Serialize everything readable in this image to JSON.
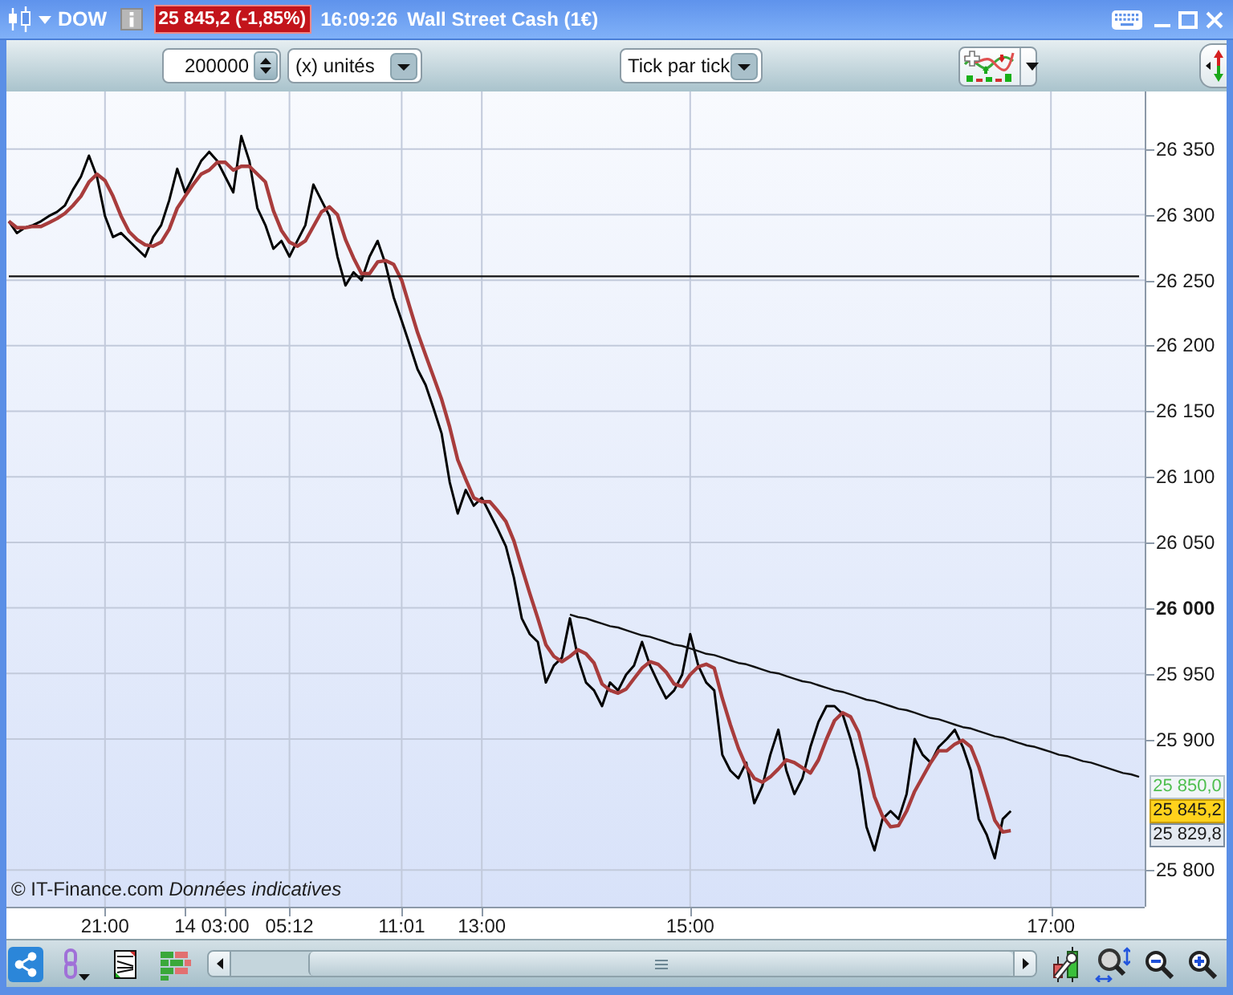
{
  "header": {
    "symbol": "DOW",
    "price_change": "25 845,2 (-1,85%)",
    "time": "16:09:26",
    "instrument": "Wall Street Cash (1€)"
  },
  "toolbar": {
    "quantity": {
      "value": "200000"
    },
    "unit_dropdown": {
      "value": "(x) unités"
    },
    "period_dropdown": {
      "value": "Tick par tick"
    }
  },
  "chart": {
    "footnote": "© IT-Finance.com *Données indicatives*",
    "chart_data": {
      "type": "line",
      "grid": true,
      "categories": [
        null,
        null,
        null,
        null,
        null,
        null,
        null,
        null,
        null,
        null,
        null,
        null,
        "21:00",
        null,
        null,
        null,
        null,
        null,
        null,
        null,
        null,
        null,
        "14",
        null,
        null,
        null,
        null,
        "03:00",
        null,
        null,
        null,
        null,
        null,
        null,
        null,
        "05:12",
        null,
        null,
        null,
        null,
        null,
        null,
        null,
        null,
        null,
        null,
        null,
        null,
        null,
        "11:01",
        null,
        null,
        null,
        null,
        null,
        null,
        null,
        null,
        null,
        "13:00",
        null,
        null,
        null,
        null,
        null,
        null,
        null,
        null,
        null,
        null,
        null,
        null,
        null,
        null,
        null,
        null,
        null,
        null,
        null,
        null,
        null,
        null,
        null,
        null,
        null,
        "15:00",
        null,
        null,
        null,
        null,
        null,
        null,
        null,
        null,
        null,
        null,
        null,
        null,
        null,
        null,
        null,
        null,
        null,
        null,
        null,
        null,
        null,
        null,
        null,
        null,
        null,
        null,
        null,
        null,
        null,
        null,
        null,
        null,
        null,
        null,
        null,
        null,
        null,
        null,
        null,
        null,
        null,
        null,
        null,
        null,
        "17:00",
        null,
        null,
        null,
        null,
        null,
        null,
        null,
        null,
        null,
        null,
        null
      ],
      "ylim": [
        25772,
        26394
      ],
      "yticks": [
        {
          "value": 25800,
          "label": "25 800"
        },
        {
          "value": 25900,
          "label": "25 900"
        },
        {
          "value": 25950,
          "label": "25 950"
        },
        {
          "value": 26000,
          "label": "26 000"
        },
        {
          "value": 26050,
          "label": "26 050"
        },
        {
          "value": 26100,
          "label": "26 100"
        },
        {
          "value": 26150,
          "label": "26 150"
        },
        {
          "value": 26200,
          "label": "26 200"
        },
        {
          "value": 26250,
          "label": "26 250"
        },
        {
          "value": 26300,
          "label": "26 300"
        },
        {
          "value": 26350,
          "label": "26 350"
        }
      ],
      "series": [
        {
          "color": "#000000",
          "values": [
            26295,
            26286,
            26290,
            26292,
            26295,
            26299,
            26302,
            26307,
            26319,
            26329,
            26345,
            26329,
            26299,
            26283,
            26286,
            26280,
            26274,
            26268,
            26283,
            26292,
            26311,
            26335,
            26317,
            26329,
            26341,
            26348,
            26341,
            26329,
            26317,
            26360,
            26341,
            26305,
            26292,
            26274,
            26280,
            26268,
            26280,
            26292,
            26323,
            26311,
            26299,
            26268,
            26246,
            26256,
            26250,
            26268,
            26280,
            26262,
            26237,
            26219,
            26201,
            26182,
            26170,
            26152,
            26133,
            26096,
            26072,
            26090,
            26078,
            26084,
            26072,
            26060,
            26047,
            26023,
            25992,
            25980,
            25974,
            25943,
            25956,
            25962,
            25992,
            25962,
            25943,
            25937,
            25925,
            25943,
            25937,
            25949,
            25956,
            25974,
            25956,
            25943,
            25931,
            25937,
            25949,
            25980,
            25956,
            25943,
            25937,
            25888,
            25876,
            25870,
            25882,
            25851,
            25864,
            25888,
            25907,
            25876,
            25858,
            25870,
            25894,
            25913,
            25925,
            25925,
            25919,
            25900,
            25876,
            25833,
            25815,
            25839,
            25845,
            25839,
            25858,
            25900,
            25888,
            25882,
            25894,
            25900,
            25907,
            25894,
            25876,
            25839,
            25827,
            25809,
            25839,
            25845,
            null,
            null,
            null,
            null,
            null,
            null,
            null,
            null,
            null,
            null,
            null,
            null,
            null,
            null,
            null,
            null
          ]
        },
        {
          "color": "#a83c3c",
          "values": [
            26295,
            26290,
            26290,
            26291,
            26291,
            26294,
            26297,
            26301,
            26307,
            26314,
            26325,
            26331,
            26326,
            26314,
            26299,
            26287,
            26281,
            26277,
            26276,
            26279,
            26289,
            26305,
            26314,
            26323,
            26331,
            26334,
            26340,
            26340,
            26334,
            26337,
            26337,
            26331,
            26325,
            26303,
            26288,
            26279,
            26276,
            26280,
            26291,
            26302,
            26306,
            26300,
            26281,
            26267,
            26255,
            26255,
            26264,
            26265,
            26262,
            26250,
            26230,
            26210,
            26193,
            26176,
            26159,
            26138,
            26113,
            26098,
            26084,
            26081,
            26081,
            26074,
            26066,
            26051,
            26031,
            26011,
            25992,
            25972,
            25963,
            25959,
            25963,
            25968,
            25965,
            25958,
            25942,
            25937,
            25935,
            25938,
            25946,
            25954,
            25959,
            25957,
            25951,
            25942,
            25940,
            25949,
            25955,
            25957,
            25954,
            25931,
            25911,
            25893,
            25879,
            25870,
            25867,
            25871,
            25877,
            25884,
            25882,
            25878,
            25874,
            25884,
            25900,
            25914,
            25920,
            25917,
            25905,
            25882,
            25856,
            25841,
            25833,
            25834,
            25845,
            25860,
            25871,
            25882,
            25891,
            25891,
            25896,
            25899,
            25894,
            25879,
            25859,
            25838,
            25829,
            25830,
            null,
            null,
            null,
            null,
            null,
            null,
            null,
            null,
            null,
            null,
            null,
            null,
            null,
            null,
            null,
            null
          ]
        },
        {
          "color": "#111111",
          "values": [
            null,
            null,
            null,
            null,
            null,
            null,
            null,
            null,
            null,
            null,
            null,
            null,
            null,
            null,
            null,
            null,
            null,
            null,
            null,
            null,
            null,
            null,
            null,
            null,
            null,
            null,
            null,
            null,
            null,
            null,
            null,
            null,
            null,
            null,
            null,
            null,
            null,
            null,
            null,
            null,
            null,
            null,
            null,
            null,
            null,
            null,
            null,
            null,
            null,
            null,
            null,
            null,
            null,
            null,
            null,
            null,
            null,
            null,
            null,
            null,
            null,
            null,
            null,
            null,
            null,
            null,
            null,
            null,
            null,
            null,
            25995,
            25993,
            25992,
            25990,
            25988,
            25986,
            25985,
            25983,
            25981,
            25979,
            25978,
            25976,
            25974,
            25972,
            25971,
            25969,
            25967,
            25965,
            25964,
            25962,
            25960,
            25958,
            25957,
            25955,
            25953,
            25951,
            25950,
            25948,
            25946,
            25944,
            25943,
            25941,
            25939,
            25937,
            25936,
            25934,
            25932,
            25930,
            25929,
            25927,
            25925,
            25923,
            25922,
            25920,
            25918,
            25916,
            25915,
            25913,
            25911,
            25909,
            25908,
            25906,
            25904,
            25902,
            25901,
            25899,
            25897,
            25895,
            25894,
            25892,
            25890,
            25888,
            25887,
            25885,
            25883,
            25882,
            25880,
            25878,
            25876,
            25874,
            25873,
            25871
          ]
        },
        {
          "color": "#111111",
          "values": [
            26253,
            26253,
            26253,
            26253,
            26253,
            26253,
            26253,
            26253,
            26253,
            26253,
            26253,
            26253,
            26253,
            26253,
            26253,
            26253,
            26253,
            26253,
            26253,
            26253,
            26253,
            26253,
            26253,
            26253,
            26253,
            26253,
            26253,
            26253,
            26253,
            26253,
            26253,
            26253,
            26253,
            26253,
            26253,
            26253,
            26253,
            26253,
            26253,
            26253,
            26253,
            26253,
            26253,
            26253,
            26253,
            26253,
            26253,
            26253,
            26253,
            26253,
            26253,
            26253,
            26253,
            26253,
            26253,
            26253,
            26253,
            26253,
            26253,
            26253,
            26253,
            26253,
            26253,
            26253,
            26253,
            26253,
            26253,
            26253,
            26253,
            26253,
            26253,
            26253,
            26253,
            26253,
            26253,
            26253,
            26253,
            26253,
            26253,
            26253,
            26253,
            26253,
            26253,
            26253,
            26253,
            26253,
            26253,
            26253,
            26253,
            26253,
            26253,
            26253,
            26253,
            26253,
            26253,
            26253,
            26253,
            26253,
            26253,
            26253,
            26253,
            26253,
            26253,
            26253,
            26253,
            26253,
            26253,
            26253,
            26253,
            26253,
            26253,
            26253,
            26253,
            26253,
            26253,
            26253,
            26253,
            26253,
            26253,
            26253,
            26253,
            26253,
            26253,
            26253,
            26253,
            26253,
            26253,
            26253,
            26253,
            26253,
            26253,
            26253,
            26253,
            26253,
            26253,
            26253,
            26253,
            26253,
            26253,
            26253,
            26253,
            26253
          ]
        }
      ],
      "annotations": [
        "25 850,0",
        "25 845,2",
        "25 829,8"
      ]
    }
  },
  "bottom_toolbar": {
    "tools": [
      {
        "kind": "share",
        "selected": true
      },
      {
        "kind": "link",
        "selected": false
      },
      {
        "kind": "notes",
        "selected": false
      },
      {
        "kind": "bricks",
        "selected": false
      }
    ]
  }
}
